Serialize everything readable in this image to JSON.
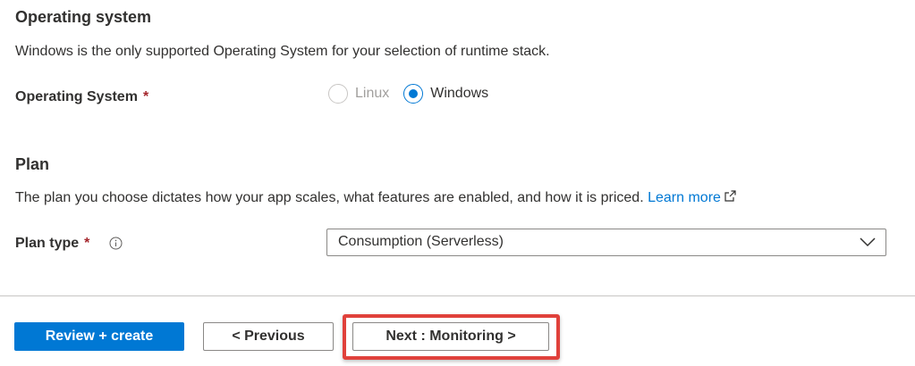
{
  "os_section": {
    "title": "Operating system",
    "description": "Windows is the only supported Operating System for your selection of runtime stack.",
    "field_label": "Operating System",
    "required_marker": "*",
    "options": [
      {
        "label": "Linux",
        "checked": false,
        "disabled": true
      },
      {
        "label": "Windows",
        "checked": true,
        "disabled": false
      }
    ]
  },
  "plan_section": {
    "title": "Plan",
    "description": "The plan you choose dictates how your app scales, what features are enabled, and how it is priced.",
    "learn_more": "Learn more",
    "field_label": "Plan type",
    "required_marker": "*",
    "selected_value": "Consumption (Serverless)"
  },
  "footer": {
    "review_label": "Review + create",
    "previous_label": "< Previous",
    "next_label": "Next : Monitoring >"
  },
  "colors": {
    "accent": "#0078d4",
    "required": "#a4262c",
    "highlight": "#e0413b"
  },
  "icons": {
    "external_link": "external-link-icon",
    "info": "info-icon",
    "chevron": "chevron-down-icon"
  }
}
